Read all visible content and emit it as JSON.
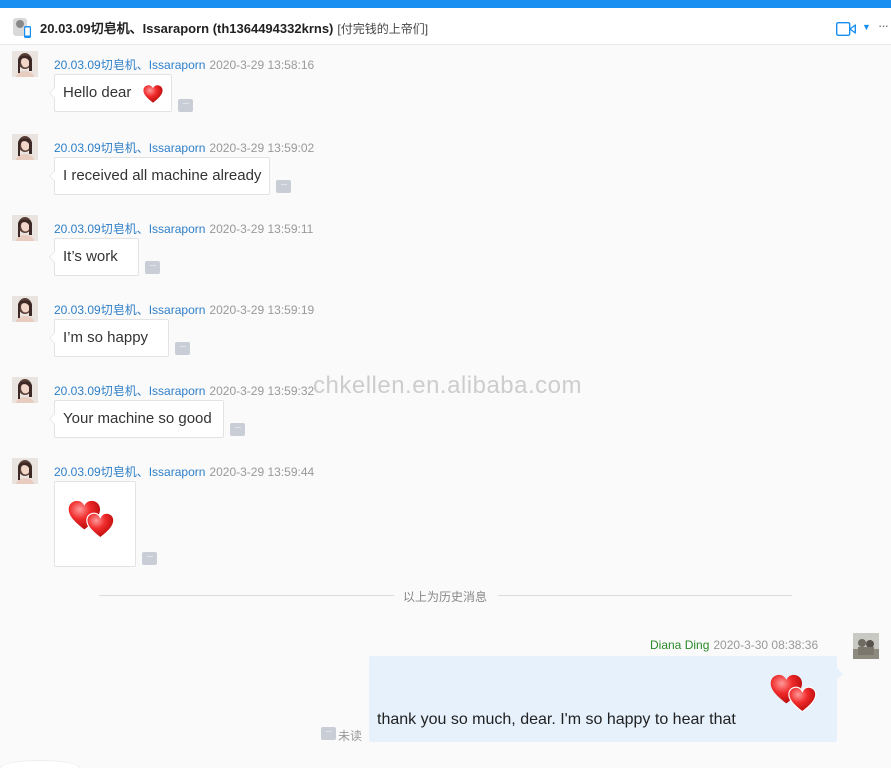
{
  "header": {
    "title": "20.03.09切皂机、Issaraporn (th1364494332krns)",
    "subtitle": "[付完钱的上帝们]",
    "more": "···"
  },
  "watermark": "chkellen.en.alibaba.com",
  "messages": [
    {
      "sender": "20.03.09切皂机、Issaraporn",
      "time": "2020-3-29 13:58:16",
      "text": "Hello dear",
      "emoji": "heart-icon"
    },
    {
      "sender": "20.03.09切皂机、Issaraporn",
      "time": "2020-3-29 13:59:02",
      "text": "I received all machine already"
    },
    {
      "sender": "20.03.09切皂机、Issaraporn",
      "time": "2020-3-29 13:59:11",
      "text": "It’s work"
    },
    {
      "sender": "20.03.09切皂机、Issaraporn",
      "time": "2020-3-29 13:59:19",
      "text": "I’m so happy"
    },
    {
      "sender": "20.03.09切皂机、Issaraporn",
      "time": "2020-3-29 13:59:32",
      "text": "Your machine so good"
    },
    {
      "sender": "20.03.09切皂机、Issaraporn",
      "time": "2020-3-29 13:59:44",
      "image": "double-heart-sticker"
    }
  ],
  "dots_label": "···",
  "history_divider": "以上为历史消息",
  "my_message": {
    "sender": "Diana Ding",
    "time": "2020-3-30 08:38:36",
    "text": "thank you so much, dear. I'm so happy to hear that",
    "sticker": "double-heart-sticker",
    "status": "未读"
  },
  "colors": {
    "accent": "#1a8ff2",
    "sender_link": "#2f7fc8",
    "my_sender": "#2a8a2a",
    "my_bubble": "#e6f1fc",
    "heart": "#e02020"
  }
}
